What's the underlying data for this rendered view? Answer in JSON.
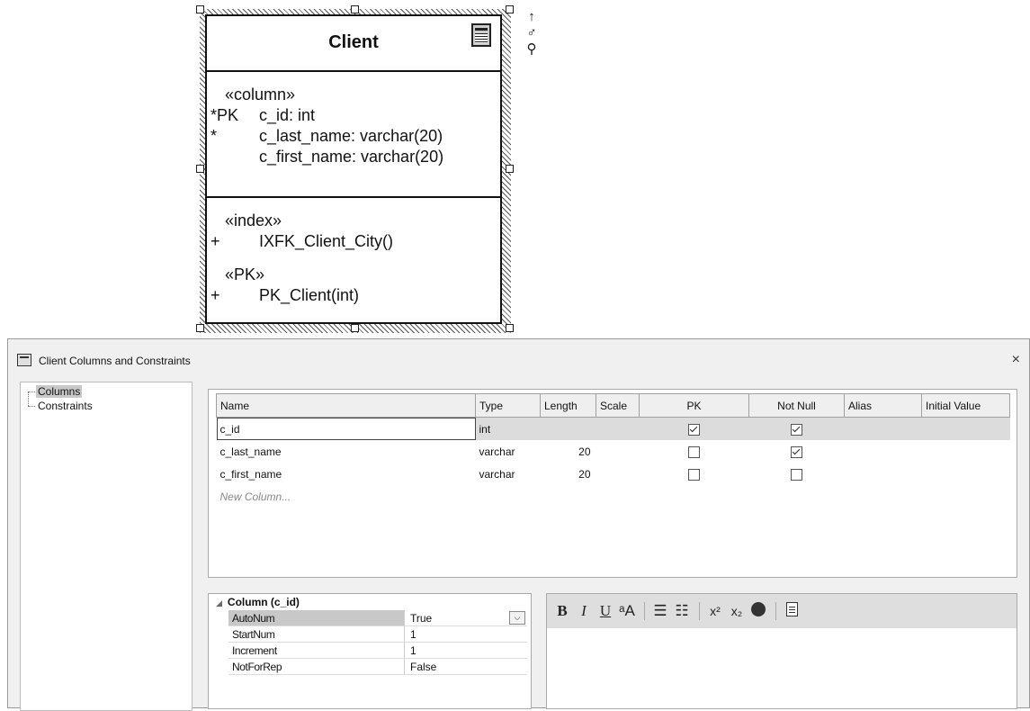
{
  "uml": {
    "class_name": "Client",
    "columns_stereotype": "«column»",
    "attributes": [
      {
        "prefix": "*PK",
        "text": "c_id: int"
      },
      {
        "prefix": "*",
        "text": "c_last_name: varchar(20)"
      },
      {
        "prefix": "",
        "text": "c_first_name: varchar(20)"
      }
    ],
    "index_stereotype": "«index»",
    "index_ops": [
      {
        "prefix": "+",
        "text": "IXFK_Client_City()"
      }
    ],
    "pk_stereotype": "«PK»",
    "pk_ops": [
      {
        "prefix": "+",
        "text": "PK_Client(int)"
      }
    ],
    "side_tools": {
      "arrow": "↑",
      "brush": "♂",
      "zoom": "⚲"
    }
  },
  "dialog": {
    "title": "Client Columns and Constraints",
    "close": "×",
    "tree": [
      "Columns",
      "Constraints"
    ],
    "grid": {
      "headers": [
        "Name",
        "Type",
        "Length",
        "Scale",
        "PK",
        "Not Null",
        "Alias",
        "Initial Value"
      ],
      "rows": [
        {
          "name": "c_id",
          "type": "int",
          "length": "",
          "scale": "",
          "pk": true,
          "not_null": true,
          "alias": "",
          "initial": ""
        },
        {
          "name": "c_last_name",
          "type": "varchar",
          "length": "20",
          "scale": "",
          "pk": false,
          "not_null": true,
          "alias": "",
          "initial": ""
        },
        {
          "name": "c_first_name",
          "type": "varchar",
          "length": "20",
          "scale": "",
          "pk": false,
          "not_null": false,
          "alias": "",
          "initial": ""
        }
      ],
      "new_row_placeholder": "New Column..."
    },
    "properties": {
      "section": "Column (c_id)",
      "collapse_glyph": "◢",
      "dropdown_glyph": "⌵",
      "rows": [
        {
          "name": "AutoNum",
          "value": "True"
        },
        {
          "name": "StartNum",
          "value": "1"
        },
        {
          "name": "Increment",
          "value": "1"
        },
        {
          "name": "NotForRep",
          "value": "False"
        }
      ]
    },
    "toolbar": {
      "bold": "B",
      "italic": "I",
      "underline": "U",
      "font_color": "ᵃA",
      "bullets": "☰",
      "numbered": "☷",
      "superscript": "x²",
      "subscript": "x₂"
    }
  }
}
